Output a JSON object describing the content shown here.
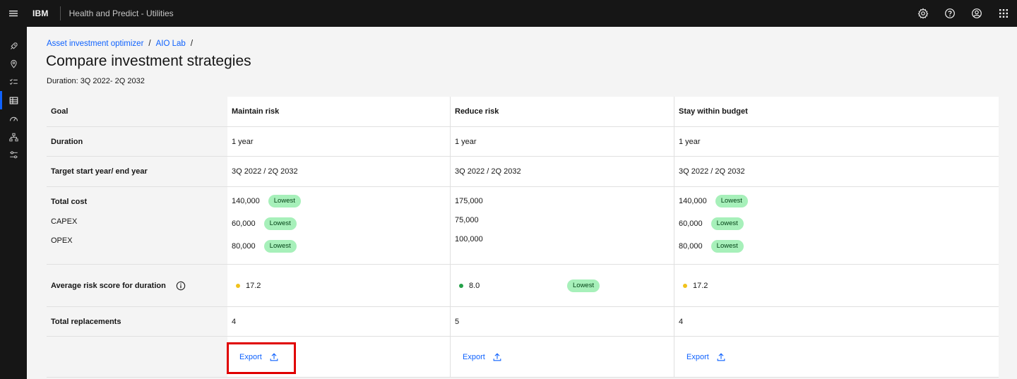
{
  "header": {
    "brand": "IBM",
    "app_title": "Health and Predict - Utilities",
    "icons": [
      "menu-icon",
      "settings-icon",
      "help-icon",
      "user-icon",
      "app-switcher-icon"
    ]
  },
  "sidebar": {
    "items": [
      {
        "icon": "rocket-icon"
      },
      {
        "icon": "location-icon"
      },
      {
        "icon": "checklist-icon"
      },
      {
        "icon": "data-table-icon",
        "active": true
      },
      {
        "icon": "dashboard-icon"
      },
      {
        "icon": "hierarchy-icon"
      },
      {
        "icon": "settings-adjust-icon"
      }
    ],
    "accent_color": "#0f62fe"
  },
  "breadcrumb": {
    "items": [
      "Asset investment optimizer",
      "AIO Lab"
    ],
    "separator": "/"
  },
  "page": {
    "title": "Compare investment strategies",
    "duration": "Duration: 3Q 2022- 2Q 2032"
  },
  "table": {
    "labels": {
      "goal": "Goal",
      "duration": "Duration",
      "target": "Target start year/ end year",
      "total_cost": "Total cost",
      "capex": "CAPEX",
      "opex": "OPEX",
      "avg_risk": "Average risk score for duration",
      "replacements": "Total replacements"
    },
    "strategies": [
      {
        "name": "Maintain risk",
        "duration": "1 year",
        "target": "3Q 2022 / 2Q 2032",
        "total_cost": "140,000",
        "capex": "60,000",
        "opex": "80,000",
        "total_cost_tag": "Lowest",
        "capex_tag": "Lowest",
        "opex_tag": "Lowest",
        "risk": "17.2",
        "risk_color": "#f1c21b",
        "replacements": "4",
        "export": "Export"
      },
      {
        "name": "Reduce risk",
        "duration": "1 year",
        "target": "3Q 2022 / 2Q 2032",
        "total_cost": "175,000",
        "capex": "75,000",
        "opex": "100,000",
        "risk": "8.0",
        "risk_color": "#24a148",
        "risk_tag": "Lowest",
        "replacements": "5",
        "export": "Export"
      },
      {
        "name": "Stay within budget",
        "duration": "1 year",
        "target": "3Q 2022 / 2Q 2032",
        "total_cost": "140,000",
        "capex": "60,000",
        "opex": "80,000",
        "total_cost_tag": "Lowest",
        "capex_tag": "Lowest",
        "opex_tag": "Lowest",
        "risk": "17.2",
        "risk_color": "#f1c21b",
        "replacements": "4",
        "export": "Export"
      }
    ],
    "tag_color": "#a7f0ba"
  }
}
